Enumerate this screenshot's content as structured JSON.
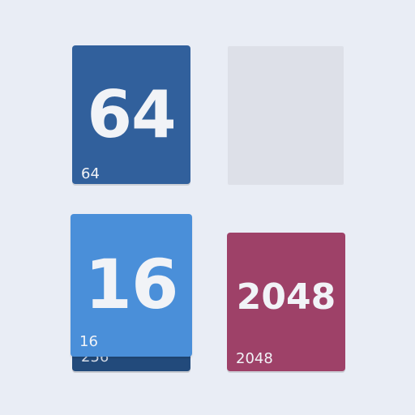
{
  "board": {
    "cards": {
      "top_left": {
        "value": "64",
        "corner_label": "64",
        "color": "#31609c"
      },
      "stacked_under": {
        "corner_label": "256",
        "color": "#224a7b"
      },
      "bottom_left": {
        "value": "16",
        "corner_label": "16",
        "color": "#4a8fd9"
      },
      "bottom_right": {
        "value": "2048",
        "corner_label": "2048",
        "color": "#9e4168"
      }
    },
    "empty_slot_color": "#dde0e8",
    "background_color": "#e9edf5"
  }
}
